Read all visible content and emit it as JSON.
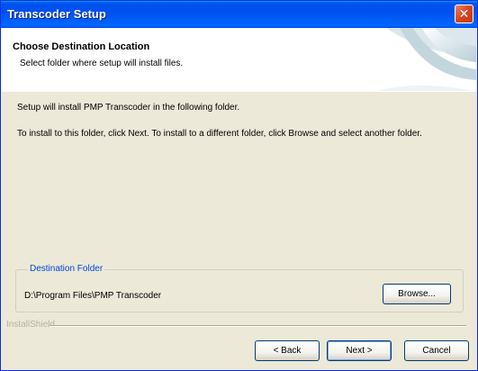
{
  "window": {
    "title": "Transcoder Setup",
    "close_glyph": "✕",
    "close_icon": "close-icon"
  },
  "header": {
    "title": "Choose Destination Location",
    "subtitle": "Select folder where setup will install files."
  },
  "body": {
    "line1": "Setup will install PMP Transcoder in the following folder.",
    "line2": "To install to this folder, click Next. To install to a different folder, click Browse and select another folder."
  },
  "destination": {
    "group_label": "Destination Folder",
    "path": "D:\\Program Files\\PMP Transcoder",
    "browse_label": "Browse..."
  },
  "footer": {
    "brand": "InstallShield",
    "back_label": "< Back",
    "next_label": "Next >",
    "cancel_label": "Cancel"
  },
  "colors": {
    "title_bar": "#0053ee",
    "accent": "#0046d5",
    "dialog_bg": "#ece9d8"
  }
}
